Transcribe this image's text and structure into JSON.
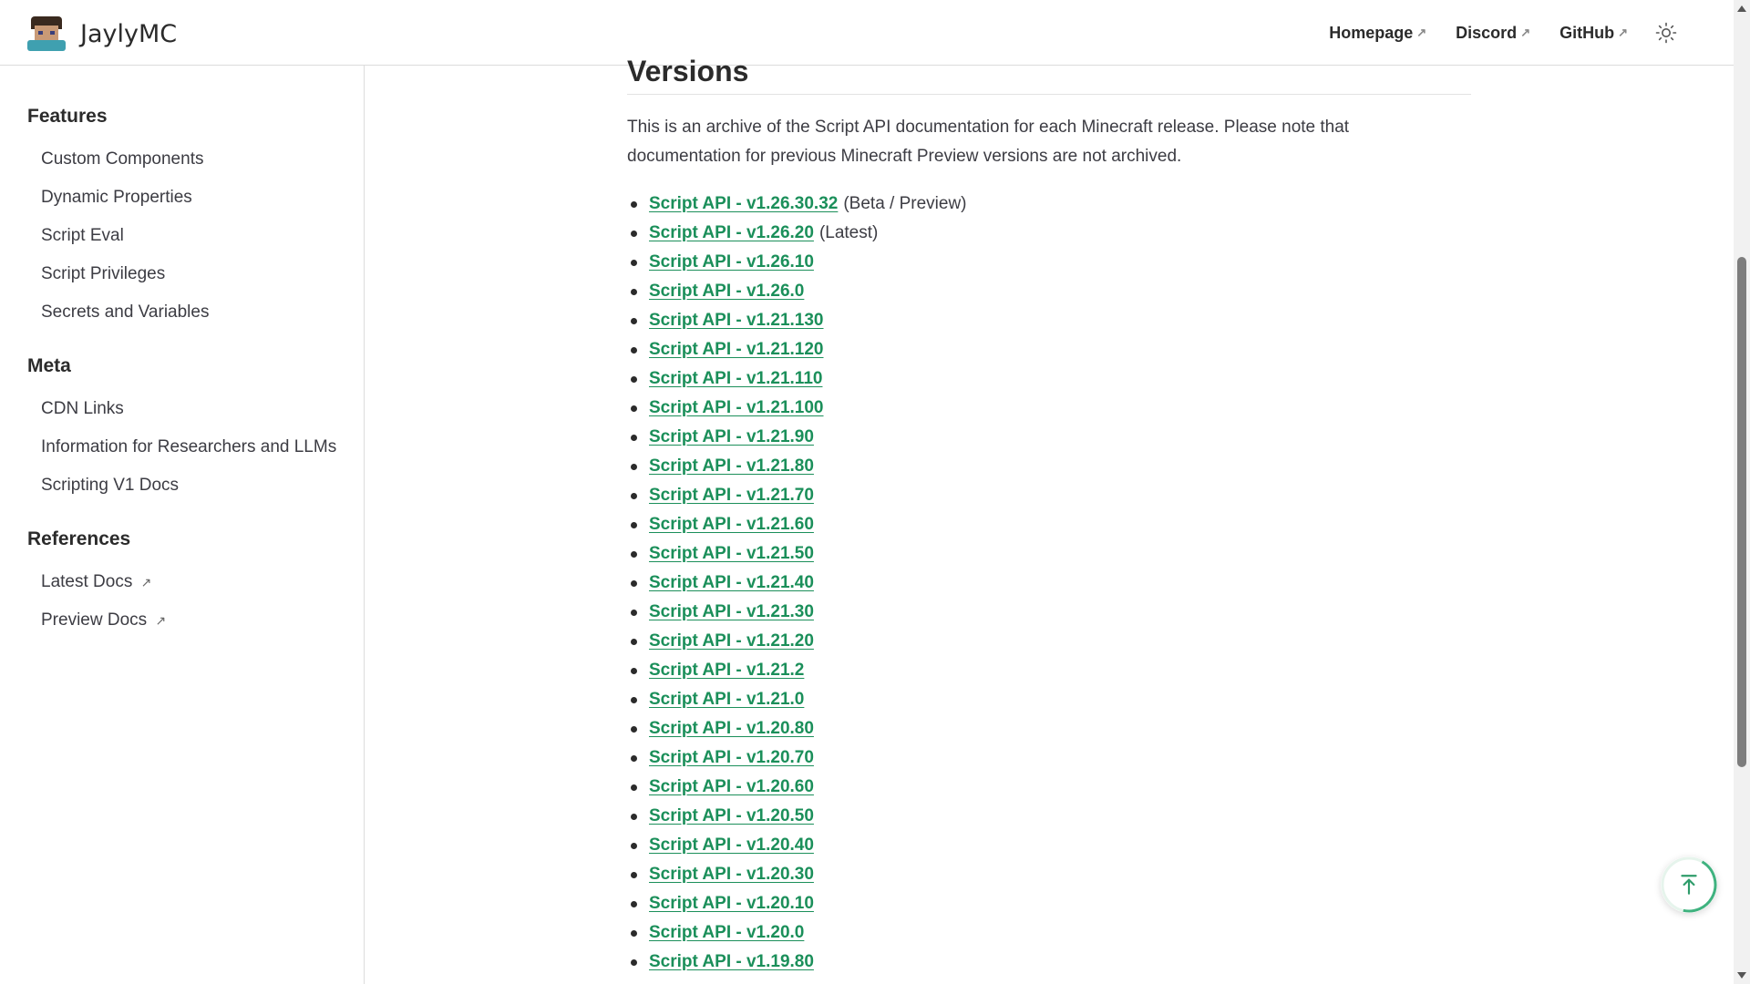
{
  "header": {
    "brand": "JaylyMC",
    "nav": [
      {
        "label": "Homepage",
        "external": "↗"
      },
      {
        "label": "Discord",
        "external": "↗"
      },
      {
        "label": "GitHub",
        "external": "↗"
      }
    ],
    "theme_icon": "sun-icon"
  },
  "sidebar": {
    "sections": [
      {
        "title": "Features",
        "items": [
          {
            "label": "Custom Components"
          },
          {
            "label": "Dynamic Properties"
          },
          {
            "label": "Script Eval"
          },
          {
            "label": "Script Privileges"
          },
          {
            "label": "Secrets and Variables"
          }
        ]
      },
      {
        "title": "Meta",
        "items": [
          {
            "label": "CDN Links"
          },
          {
            "label": "Information for Researchers and LLMs"
          },
          {
            "label": "Scripting V1 Docs"
          }
        ]
      },
      {
        "title": "References",
        "items": [
          {
            "label": "Latest Docs",
            "external": "↗"
          },
          {
            "label": "Preview Docs",
            "external": "↗"
          }
        ]
      }
    ]
  },
  "main": {
    "heading": "Versions",
    "intro": "This is an archive of the Script API documentation for each Minecraft release. Please note that documentation for previous Minecraft Preview versions are not archived.",
    "versions": [
      {
        "label": "Script API - v1.26.30.32",
        "note": "(Beta / Preview)"
      },
      {
        "label": "Script API - v1.26.20",
        "note": "(Latest)"
      },
      {
        "label": "Script API - v1.26.10"
      },
      {
        "label": "Script API - v1.26.0"
      },
      {
        "label": "Script API - v1.21.130"
      },
      {
        "label": "Script API - v1.21.120"
      },
      {
        "label": "Script API - v1.21.110"
      },
      {
        "label": "Script API - v1.21.100"
      },
      {
        "label": "Script API - v1.21.90"
      },
      {
        "label": "Script API - v1.21.80"
      },
      {
        "label": "Script API - v1.21.70"
      },
      {
        "label": "Script API - v1.21.60"
      },
      {
        "label": "Script API - v1.21.50"
      },
      {
        "label": "Script API - v1.21.40"
      },
      {
        "label": "Script API - v1.21.30"
      },
      {
        "label": "Script API - v1.21.20"
      },
      {
        "label": "Script API - v1.21.2"
      },
      {
        "label": "Script API - v1.21.0"
      },
      {
        "label": "Script API - v1.20.80"
      },
      {
        "label": "Script API - v1.20.70"
      },
      {
        "label": "Script API - v1.20.60"
      },
      {
        "label": "Script API - v1.20.50"
      },
      {
        "label": "Script API - v1.20.40"
      },
      {
        "label": "Script API - v1.20.30"
      },
      {
        "label": "Script API - v1.20.10"
      },
      {
        "label": "Script API - v1.20.0"
      },
      {
        "label": "Script API - v1.19.80"
      }
    ]
  },
  "back_to_top_icon": "arrow-up-to-line-icon",
  "colors": {
    "link": "#1b8f5a",
    "accent_ring": "#3fb27f"
  }
}
